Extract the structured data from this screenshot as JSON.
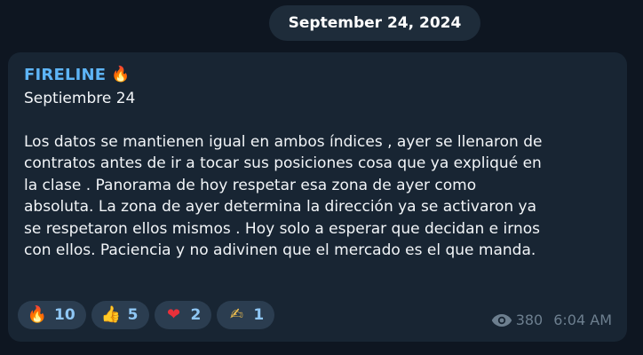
{
  "date_pill": "September 24, 2024",
  "message": {
    "sender": "FIRELINE",
    "sender_emoji": "🔥",
    "subtitle": "Septiembre 24",
    "body_lines": [
      "Los datos se mantienen igual en ambos índices , ayer se llenaron de",
      "contratos antes de ir a tocar sus posiciones cosa que ya expliqué en",
      "la clase . Panorama de hoy respetar esa zona de ayer como",
      "absoluta. La zona de ayer determina la dirección ya se activaron ya",
      "se respetaron ellos mismos . Hoy solo a esperar que decidan e irnos",
      "con ellos. Paciencia y no adivinen que el mercado es el que manda."
    ],
    "reactions": [
      {
        "emoji": "🔥",
        "icon": "fire-icon",
        "count": "10"
      },
      {
        "emoji": "👍",
        "icon": "thumbs-up-icon",
        "count": "5"
      },
      {
        "emoji": "❤",
        "icon": "heart-icon",
        "count": "2"
      },
      {
        "emoji": "✍",
        "icon": "writing-hand-icon",
        "count": "1"
      }
    ],
    "views": "380",
    "time": "6:04 AM"
  },
  "colors": {
    "background": "#0e1621",
    "bubble": "#182533",
    "sender": "#5eb5f7",
    "reaction_bg": "#2b3d50",
    "reaction_count": "#8fc7f5",
    "meta": "#6d7f8f"
  }
}
